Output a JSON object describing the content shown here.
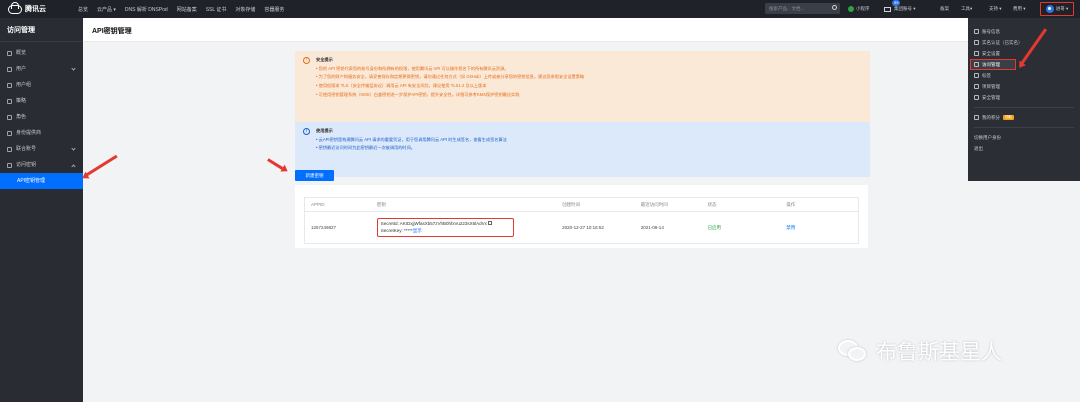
{
  "topbar": {
    "brand": "腾讯云",
    "nav": [
      "总览",
      "云产品 ▾",
      "DNS 解析 DNSPod",
      "网站备案",
      "SSL 证书",
      "对象存储",
      "容器服务"
    ],
    "search_placeholder": "搜索产品、文档...",
    "mini_program": "小程序",
    "mail_badge": "99",
    "group_account": "集团账号 ▾",
    "filing": "备案",
    "tools": "工具▾",
    "support": "支持 ▾",
    "billing": "费用 ▾",
    "user_label": "进哥 ▾"
  },
  "sidebar": {
    "title": "访问管理",
    "items": [
      {
        "label": "概览"
      },
      {
        "label": "用户"
      },
      {
        "label": "用户组"
      },
      {
        "label": "策略"
      },
      {
        "label": "角色"
      },
      {
        "label": "身份提供商"
      },
      {
        "label": "联合账号"
      },
      {
        "label": "访问密钥"
      }
    ],
    "active_sub": "API密钥管理"
  },
  "header": {
    "title": "API密钥管理"
  },
  "security_notice": {
    "title": "安全提示",
    "lines": [
      "• 您的 API 密钥代表您的账号身份和所拥有的权限，使用腾讯云 API 可以操作您名下的所有腾讯云资源。",
      "• 为了您的财产和服务安全，请妥善保存和定期更换密钥，请勿通过任何方式（如 GitHub）上传或者分享您的密钥信息。建议您参照安全设置策略",
      "• 使用低版本 TLS（安全传输层协议）调用云 API 有安全风险，建议使用 TLS1.2 及以上版本",
      "• 可使用密钥管理系统（KMS）白盒密钥进一步保护API密钥，提升安全性。详细可参考KMS保护密钥最佳实践"
    ]
  },
  "usage_notice": {
    "title": "使用提示",
    "lines": [
      "• 云API密钥是构建腾讯云 API 请求的重要凭证，用于您调用腾讯云 API 时生成签名，查看生成签名算法",
      "• 密钥最近访问时间为此密钥最近一次被调用的时间。"
    ]
  },
  "new_key_button": "新建密钥",
  "table": {
    "headers": [
      "APPID",
      "密钥",
      "创建时间",
      "最近访问时间",
      "状态",
      "操作"
    ],
    "rows": [
      {
        "appid": "1257249827",
        "secret_id": "SecretId: AKIDxjjWfasXb57zVhB0hfxVu223sX6lAdVx",
        "secret_key_label": "SecretKey: *****",
        "secret_key_link": "显示",
        "created": "2020-12-27 10:16:52",
        "last_access": "2021-08-14",
        "status": "已启用",
        "action": "禁用"
      }
    ]
  },
  "user_menu": {
    "items": [
      "账号信息",
      "实名认证（已实名）",
      "安全设置",
      "访问管理",
      "标签",
      "项目管理",
      "安全管理"
    ],
    "promo": "我的积分",
    "promo_tag": "领取",
    "switch_role": "切换用户身份",
    "logout": "退出"
  },
  "watermark": "布鲁斯基星人"
}
